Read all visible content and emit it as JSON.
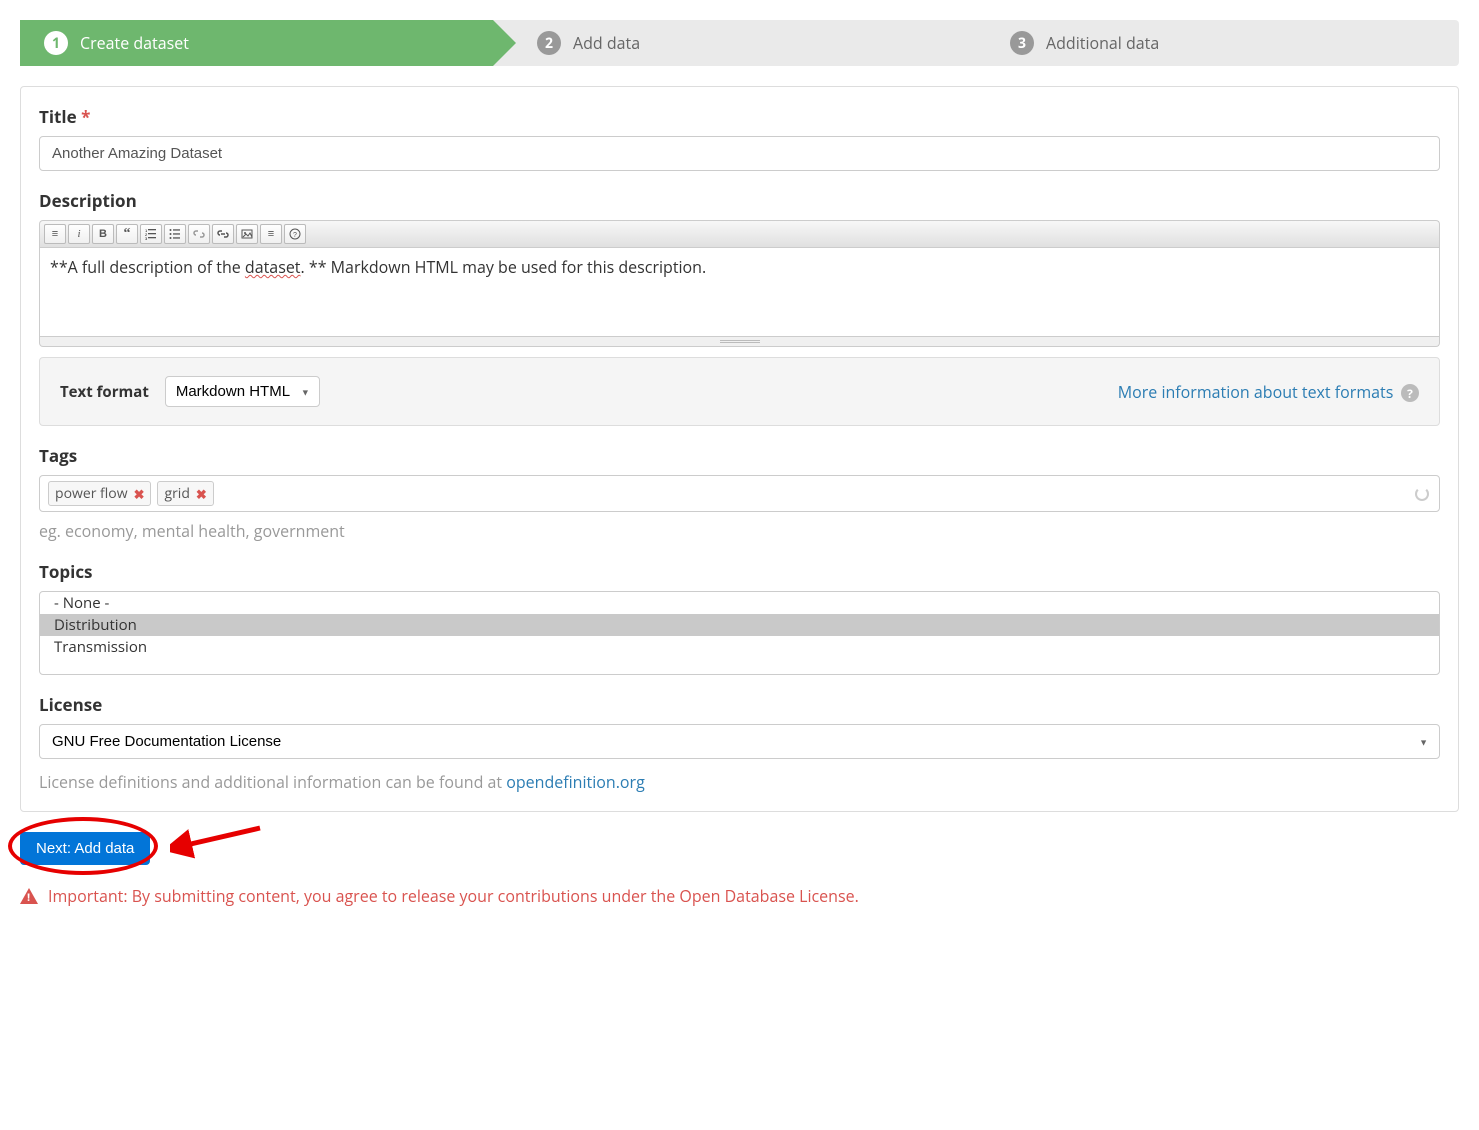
{
  "stepper": {
    "step1": {
      "num": "1",
      "label": "Create dataset"
    },
    "step2": {
      "num": "2",
      "label": "Add data"
    },
    "step3": {
      "num": "3",
      "label": "Additional data"
    }
  },
  "fields": {
    "title": {
      "label": "Title",
      "required": "*",
      "value": "Another Amazing Dataset"
    },
    "description": {
      "label": "Description",
      "value_prefix": "**A full description of the ",
      "value_mis": "dataset",
      "value_suffix": ". **  Markdown HTML may be used for this description.",
      "text_format_label": "Text format",
      "text_format_value": "Markdown HTML",
      "more_info": "More information about text formats"
    },
    "tags": {
      "label": "Tags",
      "items": [
        "power flow",
        "grid"
      ],
      "help": "eg. economy, mental health, government"
    },
    "topics": {
      "label": "Topics",
      "options": [
        "- None -",
        "Distribution",
        "Transmission"
      ],
      "selected_index": 1
    },
    "license": {
      "label": "License",
      "value": "GNU Free Documentation License",
      "help_prefix": "License definitions and additional information can be found at ",
      "help_link": "opendefinition.org"
    }
  },
  "footer": {
    "next_button": "Next: Add data",
    "important": "Important: By submitting content, you agree to release your contributions under the Open Database License."
  }
}
